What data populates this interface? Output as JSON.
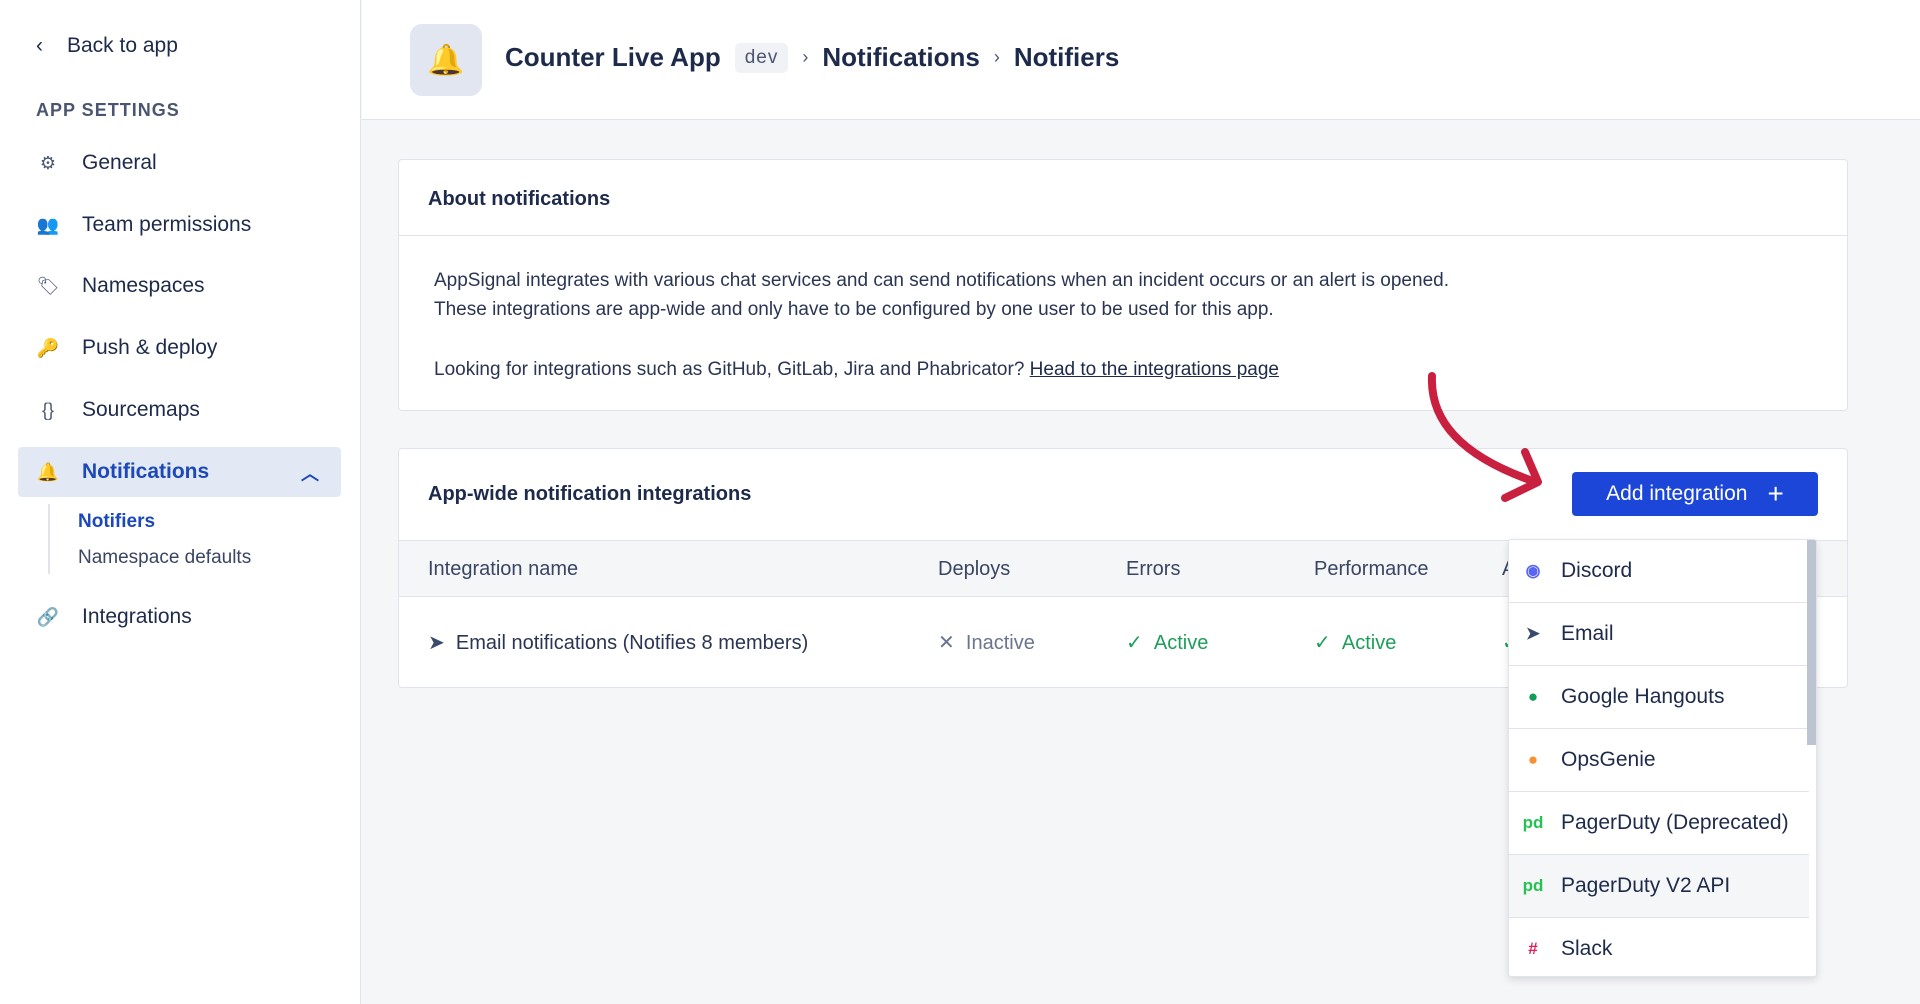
{
  "sidebar": {
    "back": "Back to app",
    "section": "APP SETTINGS",
    "items": [
      {
        "label": "General",
        "icon": "gear-icon"
      },
      {
        "label": "Team permissions",
        "icon": "users-icon"
      },
      {
        "label": "Namespaces",
        "icon": "tag-icon"
      },
      {
        "label": "Push & deploy",
        "icon": "key-icon"
      },
      {
        "label": "Sourcemaps",
        "icon": "braces-icon"
      },
      {
        "label": "Notifications",
        "icon": "bell-icon"
      },
      {
        "label": "Integrations",
        "icon": "link-icon"
      }
    ],
    "sub": [
      "Notifiers",
      "Namespace defaults"
    ]
  },
  "header": {
    "app": "Counter Live App",
    "env": "dev",
    "crumb1": "Notifications",
    "crumb2": "Notifiers"
  },
  "about": {
    "title": "About notifications",
    "p1": "AppSignal integrates with various chat services and can send notifications when an incident occurs or an alert is opened.",
    "p2": "These integrations are app-wide and only have to be configured by one user to be used for this app.",
    "p3": "Looking for integrations such as GitHub, GitLab, Jira and Phabricator?",
    "link": "Head to the integrations page"
  },
  "integrations": {
    "title": "App-wide notification integrations",
    "add": "Add integration",
    "columns": [
      "Integration name",
      "Deploys",
      "Errors",
      "Performance",
      "A"
    ],
    "row": {
      "name": "Email notifications (Notifies 8 members)",
      "deploys": "Inactive",
      "errors": "Active",
      "performance": "Active"
    }
  },
  "dropdown": [
    {
      "label": "Discord",
      "color": "#5865f2"
    },
    {
      "label": "Email",
      "color": "#3a4a6b"
    },
    {
      "label": "Google Hangouts",
      "color": "#0f9d58"
    },
    {
      "label": "OpsGenie",
      "color": "#f7902f"
    },
    {
      "label": "PagerDuty (Deprecated)",
      "color": "#25c151"
    },
    {
      "label": "PagerDuty V2 API",
      "color": "#25c151"
    },
    {
      "label": "Slack",
      "color": "#e01e5a"
    }
  ],
  "colors": {
    "accent": "#1c46d8",
    "active": "#1e9e5a",
    "arrow": "#c8203e"
  }
}
